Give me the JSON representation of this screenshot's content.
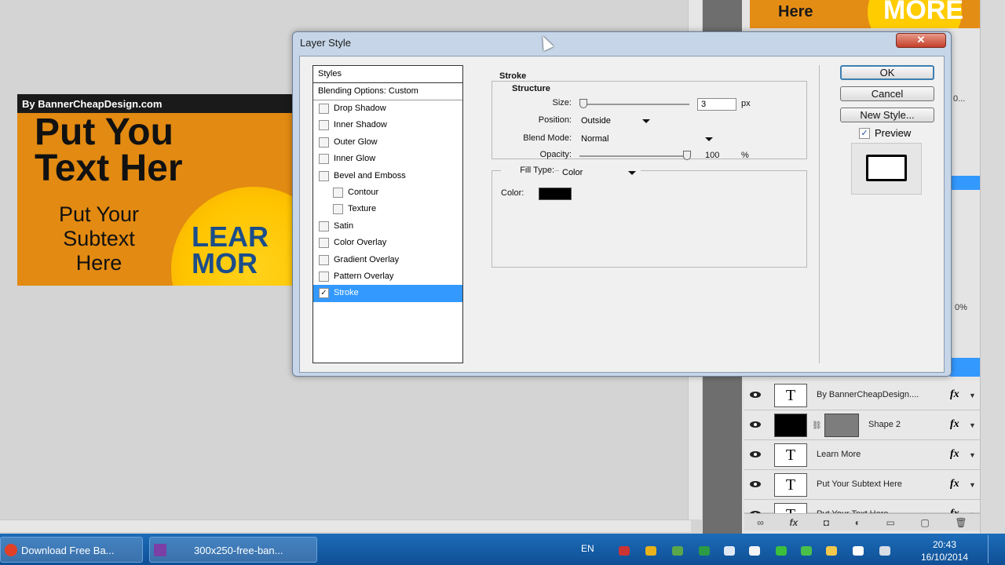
{
  "banner": {
    "byline": "By BannerCheapDesign.com",
    "headline1": "Put You",
    "headline2": "Text Her",
    "subtext1": "Put Your",
    "subtext2": "Subtext",
    "subtext3": "Here",
    "burst1": "LEAR",
    "burst2": "MOR"
  },
  "top_preview": {
    "here": "Here",
    "more": "MORE"
  },
  "right_panel": {
    "opacity_partial": "0...",
    "fill_percent": "0%"
  },
  "layers": [
    {
      "name": "By BannerCheapDesign....",
      "thumb": "T",
      "fx": "fx"
    },
    {
      "name": "Shape 2",
      "thumb": "",
      "fx": "fx"
    },
    {
      "name": "Learn More",
      "thumb": "T",
      "fx": "fx"
    },
    {
      "name": "Put Your Subtext Here",
      "thumb": "T",
      "fx": "fx"
    },
    {
      "name": "Put Your Text Here",
      "thumb": "T",
      "fx": "fx"
    }
  ],
  "dialog": {
    "title": "Layer Style",
    "close": "✕",
    "styles_header": "Styles",
    "blending_options": "Blending Options: Custom",
    "style_items": [
      {
        "label": "Drop Shadow",
        "checked": false,
        "indent": false
      },
      {
        "label": "Inner Shadow",
        "checked": false,
        "indent": false
      },
      {
        "label": "Outer Glow",
        "checked": false,
        "indent": false
      },
      {
        "label": "Inner Glow",
        "checked": false,
        "indent": false
      },
      {
        "label": "Bevel and Emboss",
        "checked": false,
        "indent": false
      },
      {
        "label": "Contour",
        "checked": false,
        "indent": true
      },
      {
        "label": "Texture",
        "checked": false,
        "indent": true
      },
      {
        "label": "Satin",
        "checked": false,
        "indent": false
      },
      {
        "label": "Color Overlay",
        "checked": false,
        "indent": false
      },
      {
        "label": "Gradient Overlay",
        "checked": false,
        "indent": false
      },
      {
        "label": "Pattern Overlay",
        "checked": false,
        "indent": false
      },
      {
        "label": "Stroke",
        "checked": true,
        "indent": false,
        "selected": true
      }
    ],
    "stroke": {
      "section_title": "Stroke",
      "structure_title": "Structure",
      "size_label": "Size:",
      "size_value": "3",
      "size_unit": "px",
      "position_label": "Position:",
      "position_value": "Outside",
      "blend_mode_label": "Blend Mode:",
      "blend_mode_value": "Normal",
      "opacity_label": "Opacity:",
      "opacity_value": "100",
      "opacity_unit": "%",
      "opacity_fraction": 1.0,
      "fill_type_label": "Fill Type:",
      "fill_type_value": "Color",
      "color_label": "Color:",
      "color_value": "#000000"
    },
    "buttons": {
      "ok": "OK",
      "cancel": "Cancel",
      "new_style": "New Style..."
    },
    "preview_label": "Preview",
    "preview_checked": true
  },
  "taskbar": {
    "tasks": [
      "Download Free Ba...",
      "300x250-free-ban..."
    ],
    "language": "EN",
    "time": "20:43",
    "date": "16/10/2014"
  }
}
